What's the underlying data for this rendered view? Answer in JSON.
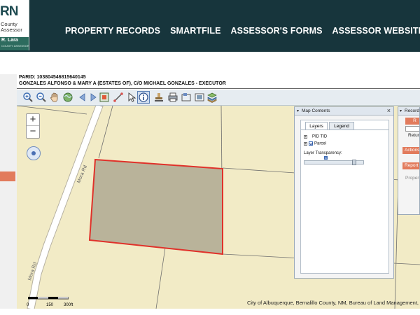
{
  "header": {
    "logo": {
      "letters": "RN",
      "county_line1": "County",
      "county_line2": "Assessor",
      "name": "R. Lara",
      "subtitle": "COUNTY ASSESSOR"
    },
    "nav": [
      "PROPERTY RECORDS",
      "SMARTFILE",
      "ASSESSOR'S FORMS",
      "ASSESSOR WEBSITE"
    ]
  },
  "parcel": {
    "id_line": "PARID: 103804546815640145",
    "owner_line": "GONZALES ALFONSO & MARY A (ESTATES OF), C/O MICHAEL GONZALES - EXECUTOR"
  },
  "toolbar": {
    "tools": [
      "zoom-in-icon",
      "zoom-out-icon",
      "pan-hand-icon",
      "globe-icon",
      "back-arrow-icon",
      "forward-arrow-icon",
      "map-extent-icon",
      "measure-icon",
      "select-icon",
      "identify-icon",
      "stamp-icon",
      "print-icon",
      "export-icon",
      "photo-icon",
      "layers-icon"
    ],
    "active_tool": "identify-icon"
  },
  "map": {
    "zoom_in_label": "+",
    "zoom_out_label": "−",
    "road_label": "Mora Rd",
    "road_label_2": "Mora Rd",
    "scale_labels": [
      "0",
      "150",
      "300ft"
    ],
    "attribution": "City of Albuquerque, Bernalillo County, NM, Bureau of Land Management,",
    "parcel_color": "#b9b39a",
    "parcel_outline": "#e0312a",
    "background_color": "#f2ebc6"
  },
  "map_contents": {
    "title": "Map Contents",
    "close": "×",
    "tabs": [
      "Layers",
      "Legend"
    ],
    "active_tab": "Layers",
    "layers": [
      {
        "label": "PID TID",
        "checked": false
      },
      {
        "label": "Parcel",
        "checked": true
      }
    ],
    "transparency_label": "Layer Transparency:",
    "transparency_value": "8"
  },
  "record_panel": {
    "title": "Record",
    "button_top": "R",
    "return_label": "Retur",
    "actions_button": "Actions",
    "reports_button": "Report",
    "properties_label": "Proper"
  }
}
